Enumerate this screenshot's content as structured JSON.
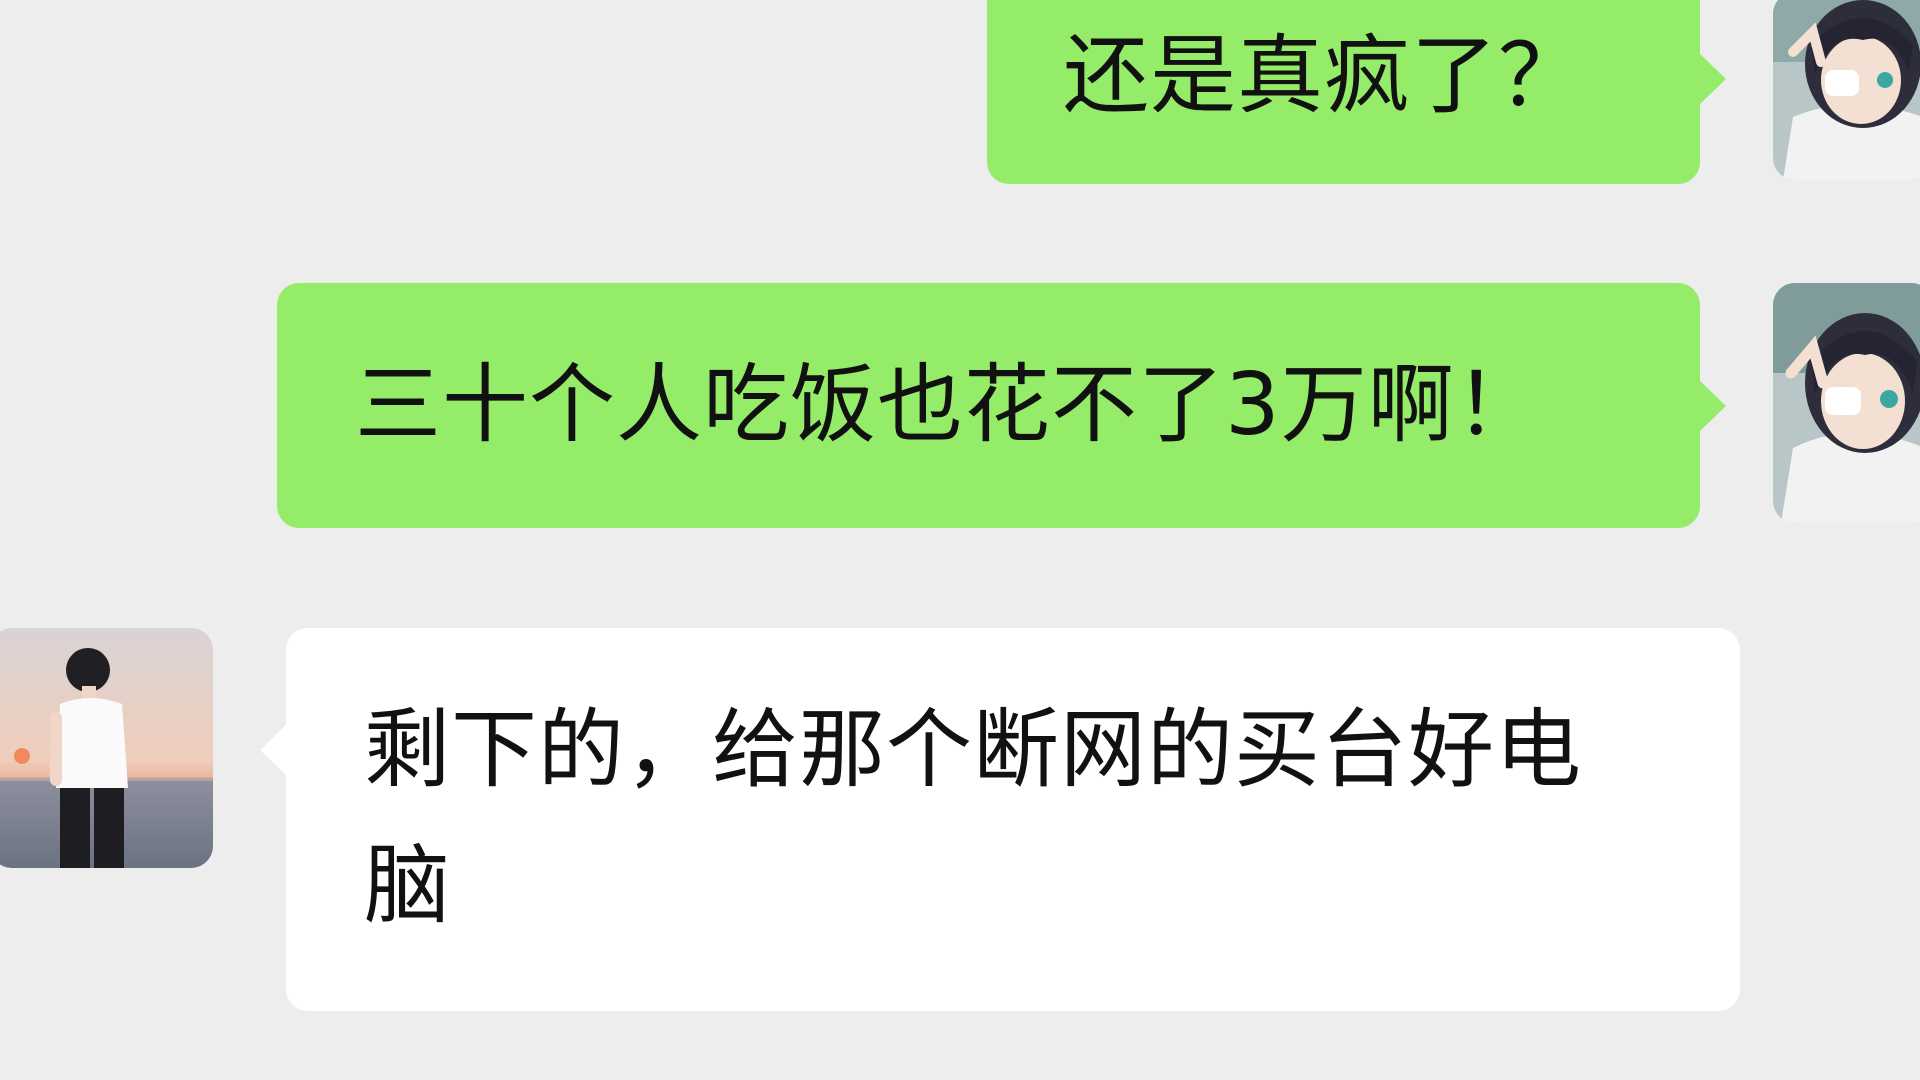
{
  "chat": {
    "messages": [
      {
        "sender": "me",
        "text": "还是真疯了？"
      },
      {
        "sender": "me",
        "text": "三十个人吃饭也花不了3万啊！"
      },
      {
        "sender": "contact",
        "text": "剩下的，给那个断网的买台好电脑"
      }
    ]
  },
  "avatars": {
    "me": "anime-girl-avatar",
    "contact": "boy-at-seaside-avatar"
  },
  "colors": {
    "background": "#ededed",
    "sent_bubble": "#95ec69",
    "received_bubble": "#ffffff",
    "text": "#111111"
  }
}
